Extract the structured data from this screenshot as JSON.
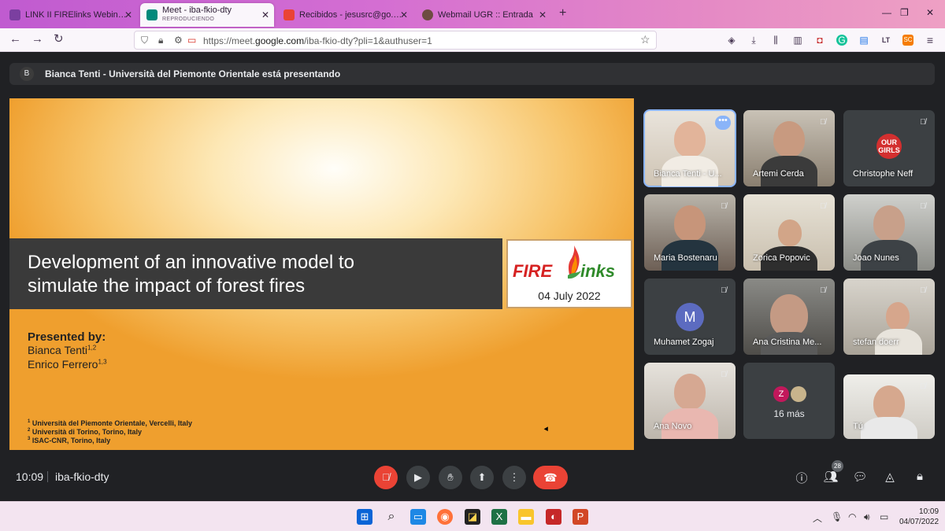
{
  "browser": {
    "tabs": [
      {
        "label": "LINK II FIRElinks Webinar and a",
        "favicon_color": "#7b3fa0"
      },
      {
        "label": "Meet - iba-fkio-dty",
        "sublabel": "REPRODUCIENDO",
        "favicon_color": "#00897b"
      },
      {
        "label": "Recibidos - jesusrc@go.ugr.es",
        "favicon_color": "#ea4335"
      },
      {
        "label": "Webmail UGR :: Entrada",
        "favicon_color": "#6d4c41"
      }
    ],
    "new_tab": "+",
    "url_prefix": "https://meet.",
    "url_host": "google.com",
    "url_path": "/iba-fkio-dty?pli=1&authuser=1"
  },
  "meet": {
    "presenter_initial": "B",
    "presenting_text": "Bianca Tenti - Università del Piemonte Orientale está presentando",
    "slide": {
      "title": "Development of an innovative model to\nsimulate the impact of forest fires",
      "logo_fire": "FIRE",
      "logo_links": "inks",
      "logo_date": "04 July 2022",
      "presented_by": "Presented by:",
      "author1": "Bianca Tenti",
      "author1_sup": "1,2",
      "author2": "Enrico Ferrero",
      "author2_sup": "1,3",
      "aff1_sup": "1",
      "aff1": "Università del Piemonte Orientale, Vercelli, Italy",
      "aff2_sup": "2",
      "aff2": "Università di Torino, Torino, Italy",
      "aff3_sup": "3",
      "aff3": "ISAC-CNR, Torino, Italy"
    },
    "participants": [
      {
        "name": "Bianca Tenti - U...",
        "speaking": true
      },
      {
        "name": "Artemi Cerda"
      },
      {
        "name": "Christophe Neff",
        "logo_text": "OUR GIRLS"
      },
      {
        "name": "Maria Bostenaru"
      },
      {
        "name": "Zorica Popovic"
      },
      {
        "name": "Joao Nunes"
      },
      {
        "name": "Muhamet Zogaj",
        "initial": "M"
      },
      {
        "name": "Ana Cristina Me..."
      },
      {
        "name": "stefan doerr"
      },
      {
        "name": "Ana Novo"
      },
      {
        "name": "Tú"
      }
    ],
    "more_tile": {
      "initial": "Z",
      "label": "16 más"
    },
    "time": "10:09",
    "meeting_code": "iba-fkio-dty",
    "participant_count": "28"
  },
  "taskbar": {
    "time": "10:09",
    "date": "04/07/2022"
  }
}
